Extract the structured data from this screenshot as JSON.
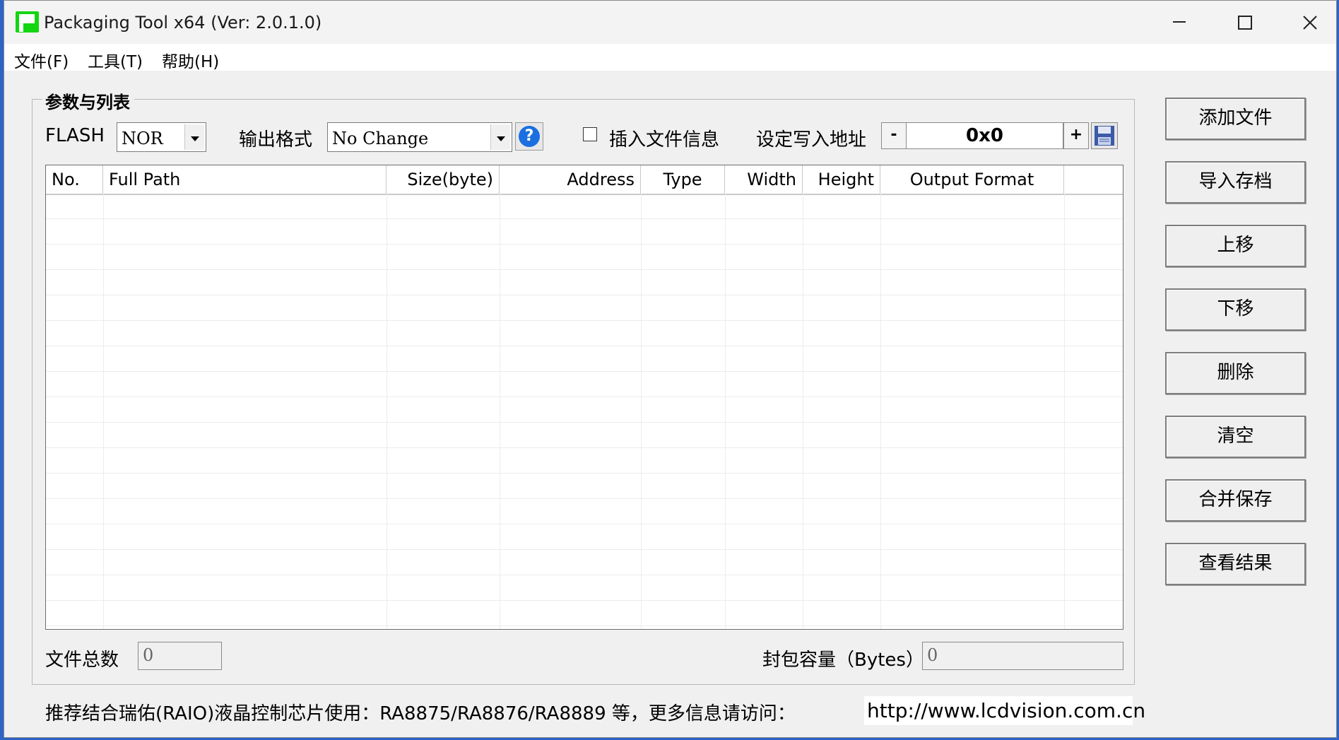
{
  "window": {
    "title": "Packaging Tool x64 (Ver: 2.0.1.0)"
  },
  "menu": {
    "file": "文件(F)",
    "tools": "工具(T)",
    "help": "帮助(H)"
  },
  "group": {
    "title": "参数与列表"
  },
  "params": {
    "flash_label": "FLASH",
    "flash_value": "NOR",
    "output_format_label": "输出格式",
    "output_format_value": "No Change",
    "insert_info_label": "插入文件信息",
    "insert_info_checked": false,
    "write_address_label": "设定写入地址",
    "address_minus": "-",
    "address_value": "0x0",
    "address_plus": "+"
  },
  "table": {
    "columns": [
      "No.",
      "Full Path",
      "Size(byte)",
      "Address",
      "Type",
      "Width",
      "Height",
      "Output Format",
      ""
    ],
    "rows": []
  },
  "buttons": {
    "add_file": "添加文件",
    "import_archive": "导入存档",
    "move_up": "上移",
    "move_down": "下移",
    "delete": "删除",
    "clear": "清空",
    "merge_save": "合并保存",
    "view_result": "查看结果"
  },
  "footer": {
    "total_files_label": "文件总数",
    "total_files_value": "0",
    "package_capacity_label": "封包容量（Bytes）",
    "package_capacity_value": "0",
    "recommend_text": "推荐结合瑞佑(RAIO)液晶控制芯片使用：RA8875/RA8876/RA8889 等，更多信息请访问：",
    "url": "http://www.lcdvision.com.cn"
  },
  "colors": {
    "desktop": "#2e63c8",
    "window_bg": "#f0f0f0",
    "app_icon": "#13d613",
    "help_icon": "#1b6fe0"
  }
}
